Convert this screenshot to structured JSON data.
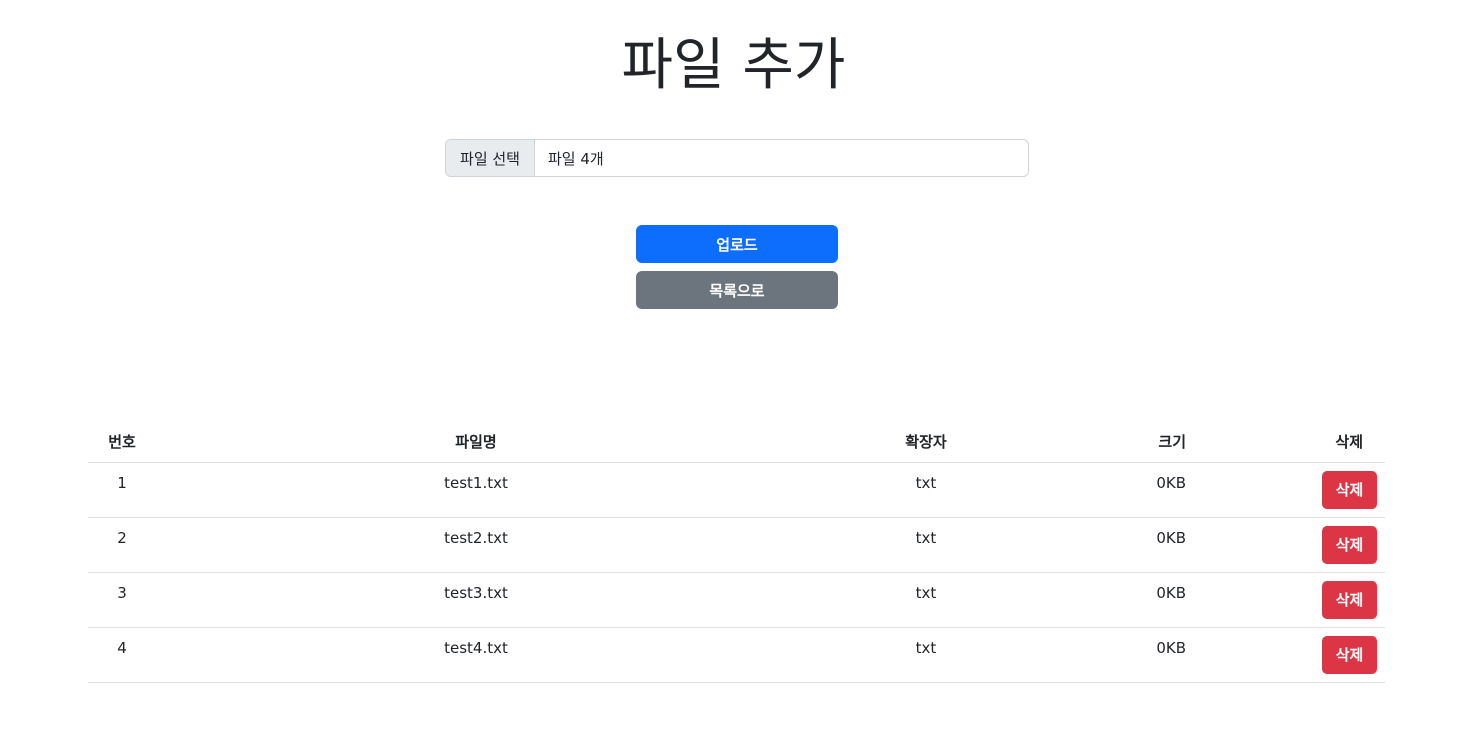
{
  "page": {
    "title": "파일 추가"
  },
  "file_input": {
    "button_label": "파일 선택",
    "status_text": "파일 4개"
  },
  "actions": {
    "upload_label": "업로드",
    "list_label": "목록으로"
  },
  "table": {
    "headers": {
      "num": "번호",
      "name": "파일명",
      "ext": "확장자",
      "size": "크기",
      "delete": "삭제"
    },
    "rows": [
      {
        "num": "1",
        "name": "test1.txt",
        "ext": "txt",
        "size": "0KB",
        "delete_label": "삭제"
      },
      {
        "num": "2",
        "name": "test2.txt",
        "ext": "txt",
        "size": "0KB",
        "delete_label": "삭제"
      },
      {
        "num": "3",
        "name": "test3.txt",
        "ext": "txt",
        "size": "0KB",
        "delete_label": "삭제"
      },
      {
        "num": "4",
        "name": "test4.txt",
        "ext": "txt",
        "size": "0KB",
        "delete_label": "삭제"
      }
    ]
  },
  "colors": {
    "primary": "#0d6efd",
    "secondary": "#6c757d",
    "danger": "#dc3545"
  }
}
